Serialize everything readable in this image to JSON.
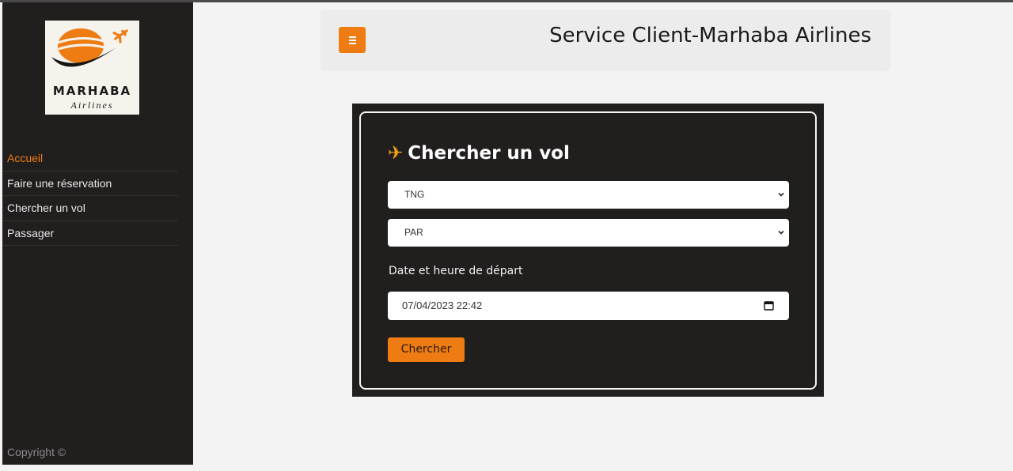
{
  "colors": {
    "accent": "#ee7c13",
    "sidebar_bg": "#211e1e",
    "page_bg": "#f3f3f3",
    "plane_icon": "#f4a21a"
  },
  "brand": {
    "logo_name": "MARHABA",
    "logo_sub": "Airlines",
    "logo_icon": "airline-logo-icon"
  },
  "sidebar": {
    "items": [
      {
        "label": "Accueil",
        "active": true
      },
      {
        "label": "Faire une réservation",
        "active": false
      },
      {
        "label": "Chercher un vol",
        "active": false
      },
      {
        "label": "Passager",
        "active": false
      }
    ],
    "copyright": "Copyright ©"
  },
  "header": {
    "menu_icon": "hamburger-menu-icon",
    "title": "Service Client-Marhaba Airlines"
  },
  "search_form": {
    "title": "Chercher un vol",
    "title_icon": "airplane-icon",
    "origin_value": "TNG",
    "destination_value": "PAR",
    "date_label": "Date et heure de départ",
    "date_value": "07/04/2023 22:42",
    "submit_label": "Chercher"
  }
}
